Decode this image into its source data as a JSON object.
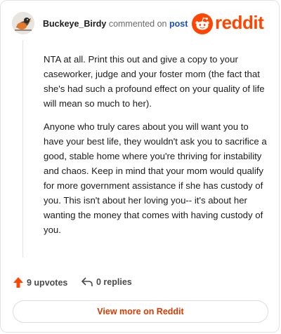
{
  "comment": {
    "username": "Buckeye_Birdy",
    "action_text": "commented on",
    "post_link": "post",
    "paragraphs": [
      "NTA at all. Print this out and give a copy to your caseworker, judge and your foster mom (the fact that she's had such a profound effect on your quality of life will mean so much to her).",
      "Anyone who truly cares about you will want you to have your best life, they wouldn't ask you to sacrifice a good, stable home where you're thriving for instability and chaos. Keep in mind that your mom would qualify for more government assistance if she has custody of you. This isn't about her loving you-- it's about her wanting the money that comes with having custody of you."
    ]
  },
  "brand": {
    "logo_text": "reddit",
    "color": "#ff4500"
  },
  "actions": {
    "upvotes": "9 upvotes",
    "replies": "0 replies"
  },
  "footer": {
    "view_more": "View more on Reddit"
  },
  "colors": {
    "link": "#1a4fb5",
    "upvote": "#ff4500",
    "view_more": "#d93a00"
  }
}
